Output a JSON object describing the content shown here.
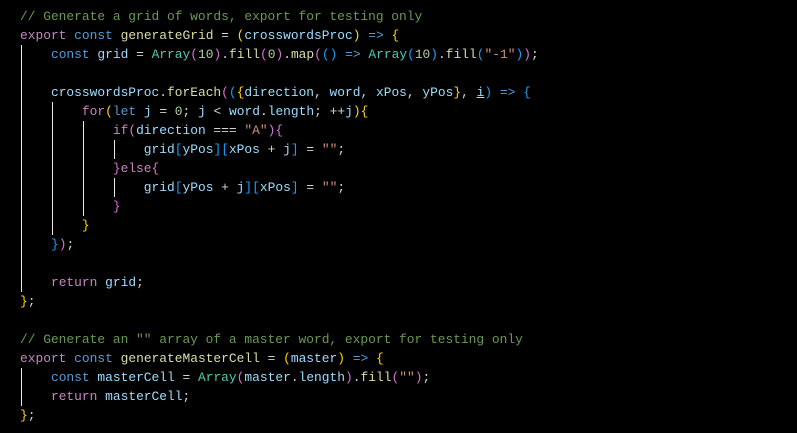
{
  "editor": {
    "theme": "dark",
    "colors": {
      "background": "#000000",
      "comment": "#6a9955",
      "keyword": "#c586c0",
      "storage": "#569cd6",
      "function": "#dcdcaa",
      "variable": "#9cdcfe",
      "class": "#4ec9b0",
      "number": "#b5cea8",
      "string": "#ce9178",
      "bracket1": "#ffd700",
      "bracket2": "#da70d6",
      "bracket3": "#179fff"
    },
    "lines": [
      [
        [
          "// Generate a grid of words, export for testing only",
          "cm"
        ]
      ],
      [
        [
          "export",
          "kw"
        ],
        [
          " ",
          "op"
        ],
        [
          "const",
          "st"
        ],
        [
          " ",
          "op"
        ],
        [
          "generateGrid",
          "fn"
        ],
        [
          " = ",
          "op"
        ],
        [
          "(",
          "b1"
        ],
        [
          "crosswordsProc",
          "vr"
        ],
        [
          ")",
          "b1"
        ],
        [
          " ",
          "op"
        ],
        [
          "=>",
          "st"
        ],
        [
          " ",
          "op"
        ],
        [
          "{",
          "b1"
        ]
      ],
      [
        [
          "    ",
          "op"
        ],
        [
          "const",
          "st"
        ],
        [
          " ",
          "op"
        ],
        [
          "grid",
          "vr"
        ],
        [
          " = ",
          "op"
        ],
        [
          "Array",
          "cl"
        ],
        [
          "(",
          "b2"
        ],
        [
          "10",
          "nm"
        ],
        [
          ")",
          "b2"
        ],
        [
          ".",
          "op"
        ],
        [
          "fill",
          "fn"
        ],
        [
          "(",
          "b2"
        ],
        [
          "0",
          "nm"
        ],
        [
          ")",
          "b2"
        ],
        [
          ".",
          "op"
        ],
        [
          "map",
          "fn"
        ],
        [
          "(",
          "b2"
        ],
        [
          "()",
          "b3"
        ],
        [
          " ",
          "op"
        ],
        [
          "=>",
          "st"
        ],
        [
          " ",
          "op"
        ],
        [
          "Array",
          "cl"
        ],
        [
          "(",
          "b3"
        ],
        [
          "10",
          "nm"
        ],
        [
          ")",
          "b3"
        ],
        [
          ".",
          "op"
        ],
        [
          "fill",
          "fn"
        ],
        [
          "(",
          "b3"
        ],
        [
          "\"-1\"",
          "str"
        ],
        [
          ")",
          "b3"
        ],
        [
          ")",
          "b2"
        ],
        [
          ";",
          "op"
        ]
      ],
      [],
      [
        [
          "    ",
          "op"
        ],
        [
          "crosswordsProc",
          "vr"
        ],
        [
          ".",
          "op"
        ],
        [
          "forEach",
          "fn"
        ],
        [
          "(",
          "b2"
        ],
        [
          "(",
          "b3"
        ],
        [
          "{",
          "b1"
        ],
        [
          "direction",
          "vr"
        ],
        [
          ", ",
          "op"
        ],
        [
          "word",
          "vr"
        ],
        [
          ", ",
          "op"
        ],
        [
          "xPos",
          "vr"
        ],
        [
          ", ",
          "op"
        ],
        [
          "yPos",
          "vr"
        ],
        [
          "}",
          "b1"
        ],
        [
          ", ",
          "op"
        ],
        [
          "i",
          "vr ul"
        ],
        [
          ")",
          "b3"
        ],
        [
          " ",
          "op"
        ],
        [
          "=>",
          "st"
        ],
        [
          " ",
          "op"
        ],
        [
          "{",
          "b3"
        ]
      ],
      [
        [
          "        ",
          "op"
        ],
        [
          "for",
          "kw"
        ],
        [
          "(",
          "b1"
        ],
        [
          "let",
          "st"
        ],
        [
          " ",
          "op"
        ],
        [
          "j",
          "vr"
        ],
        [
          " = ",
          "op"
        ],
        [
          "0",
          "nm"
        ],
        [
          "; ",
          "op"
        ],
        [
          "j",
          "vr"
        ],
        [
          " < ",
          "op"
        ],
        [
          "word",
          "vr"
        ],
        [
          ".",
          "op"
        ],
        [
          "length",
          "vr"
        ],
        [
          "; ++",
          "op"
        ],
        [
          "j",
          "vr"
        ],
        [
          ")",
          "b1"
        ],
        [
          "{",
          "b1"
        ]
      ],
      [
        [
          "            ",
          "op"
        ],
        [
          "if",
          "kw"
        ],
        [
          "(",
          "b2"
        ],
        [
          "direction",
          "vr"
        ],
        [
          " === ",
          "op"
        ],
        [
          "\"A\"",
          "str"
        ],
        [
          ")",
          "b2"
        ],
        [
          "{",
          "b2"
        ]
      ],
      [
        [
          "                ",
          "op"
        ],
        [
          "grid",
          "vr"
        ],
        [
          "[",
          "b3"
        ],
        [
          "yPos",
          "vr"
        ],
        [
          "]",
          "b3"
        ],
        [
          "[",
          "b3"
        ],
        [
          "xPos",
          "vr"
        ],
        [
          " + ",
          "op"
        ],
        [
          "j",
          "vr"
        ],
        [
          "]",
          "b3"
        ],
        [
          " = ",
          "op"
        ],
        [
          "\"\"",
          "str"
        ],
        [
          ";",
          "op"
        ]
      ],
      [
        [
          "            ",
          "op"
        ],
        [
          "}",
          "b2"
        ],
        [
          "else",
          "kw"
        ],
        [
          "{",
          "b2"
        ]
      ],
      [
        [
          "                ",
          "op"
        ],
        [
          "grid",
          "vr"
        ],
        [
          "[",
          "b3"
        ],
        [
          "yPos",
          "vr"
        ],
        [
          " + ",
          "op"
        ],
        [
          "j",
          "vr"
        ],
        [
          "]",
          "b3"
        ],
        [
          "[",
          "b3"
        ],
        [
          "xPos",
          "vr"
        ],
        [
          "]",
          "b3"
        ],
        [
          " = ",
          "op"
        ],
        [
          "\"\"",
          "str"
        ],
        [
          ";",
          "op"
        ]
      ],
      [
        [
          "            ",
          "op"
        ],
        [
          "}",
          "b2"
        ]
      ],
      [
        [
          "        ",
          "op"
        ],
        [
          "}",
          "b1"
        ]
      ],
      [
        [
          "    ",
          "op"
        ],
        [
          "}",
          "b3"
        ],
        [
          ")",
          "b2"
        ],
        [
          ";",
          "op"
        ]
      ],
      [],
      [
        [
          "    ",
          "op"
        ],
        [
          "return",
          "kw"
        ],
        [
          " ",
          "op"
        ],
        [
          "grid",
          "vr"
        ],
        [
          ";",
          "op"
        ]
      ],
      [
        [
          "}",
          "b1"
        ],
        [
          ";",
          "op"
        ]
      ],
      [],
      [
        [
          "// Generate an \"\" array of a master word, export for testing only",
          "cm"
        ]
      ],
      [
        [
          "export",
          "kw"
        ],
        [
          " ",
          "op"
        ],
        [
          "const",
          "st"
        ],
        [
          " ",
          "op"
        ],
        [
          "generateMasterCell",
          "fn"
        ],
        [
          " = ",
          "op"
        ],
        [
          "(",
          "b1"
        ],
        [
          "master",
          "vr"
        ],
        [
          ")",
          "b1"
        ],
        [
          " ",
          "op"
        ],
        [
          "=>",
          "st"
        ],
        [
          " ",
          "op"
        ],
        [
          "{",
          "b1"
        ]
      ],
      [
        [
          "    ",
          "op"
        ],
        [
          "const",
          "st"
        ],
        [
          " ",
          "op"
        ],
        [
          "masterCell",
          "vr"
        ],
        [
          " = ",
          "op"
        ],
        [
          "Array",
          "cl"
        ],
        [
          "(",
          "b2"
        ],
        [
          "master",
          "vr"
        ],
        [
          ".",
          "op"
        ],
        [
          "length",
          "vr"
        ],
        [
          ")",
          "b2"
        ],
        [
          ".",
          "op"
        ],
        [
          "fill",
          "fn"
        ],
        [
          "(",
          "b2"
        ],
        [
          "\"\"",
          "str"
        ],
        [
          ")",
          "b2"
        ],
        [
          ";",
          "op"
        ]
      ],
      [
        [
          "    ",
          "op"
        ],
        [
          "return",
          "kw"
        ],
        [
          " ",
          "op"
        ],
        [
          "masterCell",
          "vr"
        ],
        [
          ";",
          "op"
        ]
      ],
      [
        [
          "}",
          "b1"
        ],
        [
          ";",
          "op"
        ]
      ]
    ]
  }
}
